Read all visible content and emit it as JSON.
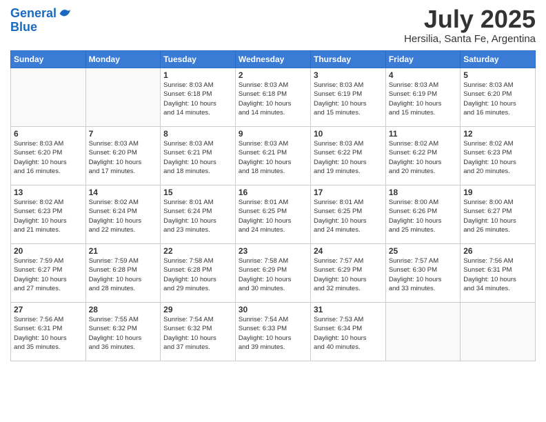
{
  "header": {
    "logo_line1": "General",
    "logo_line2": "Blue",
    "month": "July 2025",
    "location": "Hersilia, Santa Fe, Argentina"
  },
  "days_of_week": [
    "Sunday",
    "Monday",
    "Tuesday",
    "Wednesday",
    "Thursday",
    "Friday",
    "Saturday"
  ],
  "weeks": [
    [
      {
        "day": "",
        "empty": true
      },
      {
        "day": "",
        "empty": true
      },
      {
        "day": "1",
        "sunrise": "8:03 AM",
        "sunset": "6:18 PM",
        "daylight": "10 hours and 14 minutes."
      },
      {
        "day": "2",
        "sunrise": "8:03 AM",
        "sunset": "6:18 PM",
        "daylight": "10 hours and 14 minutes."
      },
      {
        "day": "3",
        "sunrise": "8:03 AM",
        "sunset": "6:19 PM",
        "daylight": "10 hours and 15 minutes."
      },
      {
        "day": "4",
        "sunrise": "8:03 AM",
        "sunset": "6:19 PM",
        "daylight": "10 hours and 15 minutes."
      },
      {
        "day": "5",
        "sunrise": "8:03 AM",
        "sunset": "6:20 PM",
        "daylight": "10 hours and 16 minutes."
      }
    ],
    [
      {
        "day": "6",
        "sunrise": "8:03 AM",
        "sunset": "6:20 PM",
        "daylight": "10 hours and 16 minutes."
      },
      {
        "day": "7",
        "sunrise": "8:03 AM",
        "sunset": "6:20 PM",
        "daylight": "10 hours and 17 minutes."
      },
      {
        "day": "8",
        "sunrise": "8:03 AM",
        "sunset": "6:21 PM",
        "daylight": "10 hours and 18 minutes."
      },
      {
        "day": "9",
        "sunrise": "8:03 AM",
        "sunset": "6:21 PM",
        "daylight": "10 hours and 18 minutes."
      },
      {
        "day": "10",
        "sunrise": "8:03 AM",
        "sunset": "6:22 PM",
        "daylight": "10 hours and 19 minutes."
      },
      {
        "day": "11",
        "sunrise": "8:02 AM",
        "sunset": "6:22 PM",
        "daylight": "10 hours and 20 minutes."
      },
      {
        "day": "12",
        "sunrise": "8:02 AM",
        "sunset": "6:23 PM",
        "daylight": "10 hours and 20 minutes."
      }
    ],
    [
      {
        "day": "13",
        "sunrise": "8:02 AM",
        "sunset": "6:23 PM",
        "daylight": "10 hours and 21 minutes."
      },
      {
        "day": "14",
        "sunrise": "8:02 AM",
        "sunset": "6:24 PM",
        "daylight": "10 hours and 22 minutes."
      },
      {
        "day": "15",
        "sunrise": "8:01 AM",
        "sunset": "6:24 PM",
        "daylight": "10 hours and 23 minutes."
      },
      {
        "day": "16",
        "sunrise": "8:01 AM",
        "sunset": "6:25 PM",
        "daylight": "10 hours and 24 minutes."
      },
      {
        "day": "17",
        "sunrise": "8:01 AM",
        "sunset": "6:25 PM",
        "daylight": "10 hours and 24 minutes."
      },
      {
        "day": "18",
        "sunrise": "8:00 AM",
        "sunset": "6:26 PM",
        "daylight": "10 hours and 25 minutes."
      },
      {
        "day": "19",
        "sunrise": "8:00 AM",
        "sunset": "6:27 PM",
        "daylight": "10 hours and 26 minutes."
      }
    ],
    [
      {
        "day": "20",
        "sunrise": "7:59 AM",
        "sunset": "6:27 PM",
        "daylight": "10 hours and 27 minutes."
      },
      {
        "day": "21",
        "sunrise": "7:59 AM",
        "sunset": "6:28 PM",
        "daylight": "10 hours and 28 minutes."
      },
      {
        "day": "22",
        "sunrise": "7:58 AM",
        "sunset": "6:28 PM",
        "daylight": "10 hours and 29 minutes."
      },
      {
        "day": "23",
        "sunrise": "7:58 AM",
        "sunset": "6:29 PM",
        "daylight": "10 hours and 30 minutes."
      },
      {
        "day": "24",
        "sunrise": "7:57 AM",
        "sunset": "6:29 PM",
        "daylight": "10 hours and 32 minutes."
      },
      {
        "day": "25",
        "sunrise": "7:57 AM",
        "sunset": "6:30 PM",
        "daylight": "10 hours and 33 minutes."
      },
      {
        "day": "26",
        "sunrise": "7:56 AM",
        "sunset": "6:31 PM",
        "daylight": "10 hours and 34 minutes."
      }
    ],
    [
      {
        "day": "27",
        "sunrise": "7:56 AM",
        "sunset": "6:31 PM",
        "daylight": "10 hours and 35 minutes."
      },
      {
        "day": "28",
        "sunrise": "7:55 AM",
        "sunset": "6:32 PM",
        "daylight": "10 hours and 36 minutes."
      },
      {
        "day": "29",
        "sunrise": "7:54 AM",
        "sunset": "6:32 PM",
        "daylight": "10 hours and 37 minutes."
      },
      {
        "day": "30",
        "sunrise": "7:54 AM",
        "sunset": "6:33 PM",
        "daylight": "10 hours and 39 minutes."
      },
      {
        "day": "31",
        "sunrise": "7:53 AM",
        "sunset": "6:34 PM",
        "daylight": "10 hours and 40 minutes."
      },
      {
        "day": "",
        "empty": true
      },
      {
        "day": "",
        "empty": true
      }
    ]
  ],
  "labels": {
    "sunrise": "Sunrise:",
    "sunset": "Sunset:",
    "daylight": "Daylight:"
  }
}
